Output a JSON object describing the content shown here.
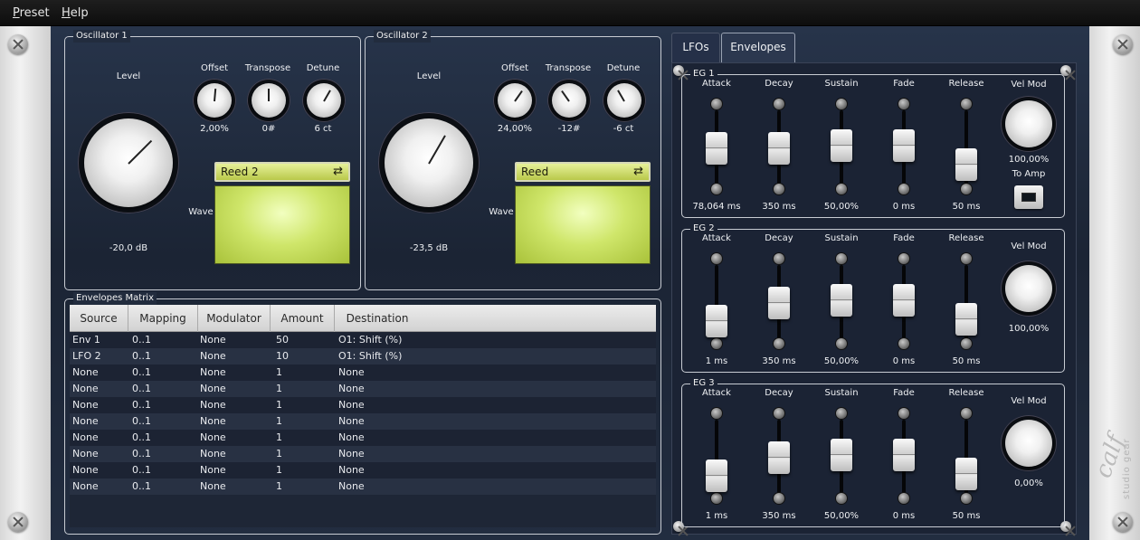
{
  "menu": {
    "preset": "Preset",
    "preset_acc": "P",
    "preset_rest": "reset",
    "help": "Help",
    "help_acc": "H",
    "help_rest": "elp"
  },
  "osc1": {
    "title": "Oscillator 1",
    "level_label": "Level",
    "level_value": "-20,0 dB",
    "offset_label": "Offset",
    "offset_value": "2,00%",
    "transpose_label": "Transpose",
    "transpose_value": "0#",
    "detune_label": "Detune",
    "detune_value": "6 ct",
    "wave_label": "Wave",
    "wave_value": "Reed 2"
  },
  "osc2": {
    "title": "Oscillator 2",
    "level_label": "Level",
    "level_value": "-23,5 dB",
    "offset_label": "Offset",
    "offset_value": "24,00%",
    "transpose_label": "Transpose",
    "transpose_value": "-12#",
    "detune_label": "Detune",
    "detune_value": "-6 ct",
    "wave_label": "Wave",
    "wave_value": "Reed"
  },
  "matrix": {
    "title": "Envelopes Matrix",
    "headers": [
      "Source",
      "Mapping",
      "Modulator",
      "Amount",
      "Destination"
    ],
    "rows": [
      [
        "Env 1",
        "0..1",
        "None",
        "50",
        "O1: Shift (%)"
      ],
      [
        "LFO 2",
        "0..1",
        "None",
        "10",
        "O1: Shift (%)"
      ],
      [
        "None",
        "0..1",
        "None",
        "1",
        "None"
      ],
      [
        "None",
        "0..1",
        "None",
        "1",
        "None"
      ],
      [
        "None",
        "0..1",
        "None",
        "1",
        "None"
      ],
      [
        "None",
        "0..1",
        "None",
        "1",
        "None"
      ],
      [
        "None",
        "0..1",
        "None",
        "1",
        "None"
      ],
      [
        "None",
        "0..1",
        "None",
        "1",
        "None"
      ],
      [
        "None",
        "0..1",
        "None",
        "1",
        "None"
      ],
      [
        "None",
        "0..1",
        "None",
        "1",
        "None"
      ]
    ]
  },
  "tabs": [
    {
      "label": "LFOs",
      "active": false
    },
    {
      "label": "Envelopes",
      "active": true
    }
  ],
  "eg": [
    {
      "title": "EG 1",
      "attack": "78,064 ms",
      "decay": "350 ms",
      "sustain": "50,00%",
      "fade": "0 ms",
      "release": "50 ms",
      "velmod_label": "Vel Mod",
      "velmod": "100,00%",
      "toamp_label": "To Amp",
      "levels": {
        "attack": 0.55,
        "decay": 0.55,
        "sustain": 0.6,
        "fade": 0.6,
        "release": 0.25
      }
    },
    {
      "title": "EG 2",
      "attack": "1 ms",
      "decay": "350 ms",
      "sustain": "50,00%",
      "fade": "0 ms",
      "release": "50 ms",
      "velmod_label": "Vel Mod",
      "velmod": "100,00%",
      "levels": {
        "attack": 0.2,
        "decay": 0.55,
        "sustain": 0.6,
        "fade": 0.6,
        "release": 0.25
      }
    },
    {
      "title": "EG 3",
      "attack": "1 ms",
      "decay": "350 ms",
      "sustain": "50,00%",
      "fade": "0 ms",
      "release": "50 ms",
      "velmod_label": "Vel Mod",
      "velmod": "0,00%",
      "levels": {
        "attack": 0.2,
        "decay": 0.55,
        "sustain": 0.6,
        "fade": 0.6,
        "release": 0.25
      }
    }
  ],
  "param_labels": {
    "attack": "Attack",
    "decay": "Decay",
    "sustain": "Sustain",
    "fade": "Fade",
    "release": "Release"
  },
  "icons": {
    "screw": "screw-icon",
    "wave_cycle": "swap-arrows-icon",
    "brand": "calf-logo"
  }
}
